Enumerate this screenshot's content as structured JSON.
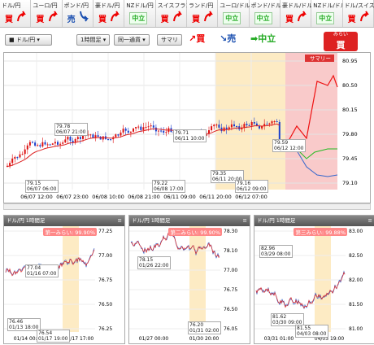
{
  "tabs": [
    {
      "label": "ドル/円",
      "signal": "買",
      "type": "buy"
    },
    {
      "label": "ユーロ/円",
      "signal": "買",
      "type": "buy"
    },
    {
      "label": "ポンド/円",
      "signal": "売",
      "type": "sell"
    },
    {
      "label": "豪ドル/円",
      "signal": "買",
      "type": "buy"
    },
    {
      "label": "NZドル/円",
      "signal": "中立",
      "type": "neu"
    },
    {
      "label": "スイスフラン/円",
      "signal": "買",
      "type": "buy"
    },
    {
      "label": "ランド/円",
      "signal": "買",
      "type": "buy"
    },
    {
      "label": "ユーロ/ドル",
      "signal": "中立",
      "type": "neu"
    },
    {
      "label": "ポンド/ドル",
      "signal": "中立",
      "type": "neu"
    },
    {
      "label": "豪ドル/ドル",
      "signal": "買",
      "type": "buy"
    },
    {
      "label": "NZドル/ドル",
      "signal": "中立",
      "type": "neu"
    },
    {
      "label": "ドル/スイス",
      "signal": "買",
      "type": "buy"
    }
  ],
  "toolbar": {
    "pair": "ドル/円",
    "timeframe": "1時間足",
    "mode": "同一通貨",
    "summary": "サマリ",
    "buy": "買",
    "sell": "売",
    "neutral": "中立",
    "mirai_top": "みらい",
    "mirai_signal": "買"
  },
  "main": {
    "summary_tag": "サマリー",
    "y_ticks": [
      "80.95",
      "80.50",
      "80.15",
      "79.80",
      "79.45",
      "79.10"
    ],
    "x_ticks": [
      "06/07 12:00",
      "06/07 23:00",
      "06/08 10:00",
      "06/08 21:00",
      "06/11 09:00",
      "06/11 20:00",
      "06/12 07:00"
    ],
    "labels": [
      {
        "t": "79.78\n06/07 21:00"
      },
      {
        "t": "79.15\n06/07 06:00"
      },
      {
        "t": "79.71\n06/11 10:00"
      },
      {
        "t": "79.22\n06/08 17:00"
      },
      {
        "t": "79.35\n06/11 20:00"
      },
      {
        "t": "79.16\n06/12 09:00"
      },
      {
        "t": "79.59\n06/12 12:00"
      }
    ],
    "colors": {
      "up": "#d11",
      "down": "#1a3fcc",
      "ma": "#d22",
      "forecast": "#fdebc4",
      "future": "#f9caca"
    }
  },
  "panels": [
    {
      "title": "ドル/円 1時間足",
      "pct": "第一みらい: 99.90%",
      "y_ticks": [
        "77.25",
        "77.00",
        "76.75",
        "76.50",
        "76.25"
      ],
      "x_ticks": [
        "01/14 00:00",
        "01/17 17:00"
      ],
      "labels": [
        {
          "t": "77.04\n01/16 07:00"
        },
        {
          "t": "76.46\n01/13 18:00"
        },
        {
          "t": "76.54\n01/17 19:00"
        }
      ]
    },
    {
      "title": "ドル/円 1時間足",
      "pct": "第二みらい: 99.90%",
      "y_ticks": [
        "78.30",
        "78.10",
        "77.00",
        "76.75",
        "76.50",
        "76.05"
      ],
      "x_ticks": [
        "01/27 00:00",
        "01/30 20:00"
      ],
      "labels": [
        {
          "t": "78.15\n01/26 22:00"
        },
        {
          "t": "76.20\n01/31 02:00"
        }
      ]
    },
    {
      "title": "ドル/円 1時間足",
      "pct": "第三みらい: 99.88%",
      "y_ticks": [
        "83.00",
        "82.50",
        "82.00",
        "81.50",
        "81.00"
      ],
      "x_ticks": [
        "03/31 01:00",
        "04/03 19:00"
      ],
      "labels": [
        {
          "t": "82.96\n03/29 08:00"
        },
        {
          "t": "81.62\n03/30 09:00"
        },
        {
          "t": "81.55\n04/03 08:00"
        }
      ]
    }
  ]
}
